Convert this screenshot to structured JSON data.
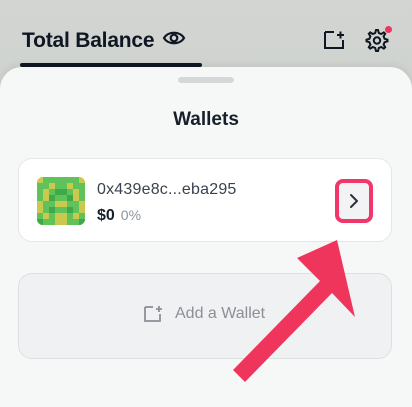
{
  "header": {
    "title": "Total Balance"
  },
  "sheet": {
    "title": "Wallets"
  },
  "wallet": {
    "address": "0x439e8c...eba295",
    "balance": "$0",
    "change": "0%"
  },
  "add_wallet": {
    "label": "Add a Wallet"
  },
  "colors": {
    "highlight": "#f2366a",
    "notification": "#f0355c",
    "avatar_green": "#5fc35a",
    "avatar_yellow": "#c9c94d"
  },
  "icons": [
    "eye-icon",
    "add-card-icon",
    "gear-icon",
    "chevron-right-icon",
    "add-wallet-icon",
    "pointer-arrow"
  ]
}
